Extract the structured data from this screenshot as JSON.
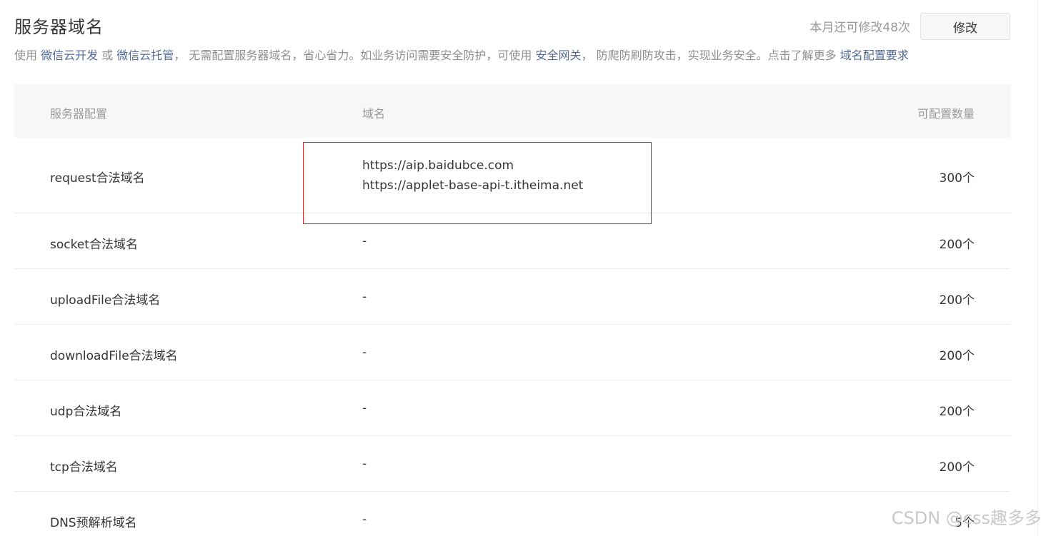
{
  "header": {
    "title": "服务器域名",
    "quota_text": "本月还可修改48次",
    "modify_label": "修改"
  },
  "description": {
    "prefix": "使用 ",
    "link1": "微信云开发",
    "or": " 或 ",
    "link2": "微信云托管",
    "middle": "， 无需配置服务器域名，省心省力。如业务访问需要安全防护，可使用 ",
    "link3": "安全网关",
    "suffix": "， 防爬防刷防攻击，实现业务安全。点击了解更多 ",
    "link4": "域名配置要求"
  },
  "table": {
    "columns": [
      "服务器配置",
      "域名",
      "可配置数量"
    ],
    "rows": [
      {
        "name": "request合法域名",
        "domains": [
          "https://aip.baidubce.com",
          "https://applet-base-api-t.itheima.net"
        ],
        "count": "300个"
      },
      {
        "name": "socket合法域名",
        "domains": [
          "-"
        ],
        "count": "200个"
      },
      {
        "name": "uploadFile合法域名",
        "domains": [
          "-"
        ],
        "count": "200个"
      },
      {
        "name": "downloadFile合法域名",
        "domains": [
          "-"
        ],
        "count": "200个"
      },
      {
        "name": "udp合法域名",
        "domains": [
          "-"
        ],
        "count": "200个"
      },
      {
        "name": "tcp合法域名",
        "domains": [
          "-"
        ],
        "count": "200个"
      },
      {
        "name": "DNS预解析域名",
        "domains": [
          "-"
        ],
        "count": "5个"
      }
    ]
  },
  "watermark": "CSDN @css趣多多",
  "colors": {
    "link": "#576b95",
    "highlight_border": "#d4282d",
    "header_bg": "#f6f7f9"
  }
}
